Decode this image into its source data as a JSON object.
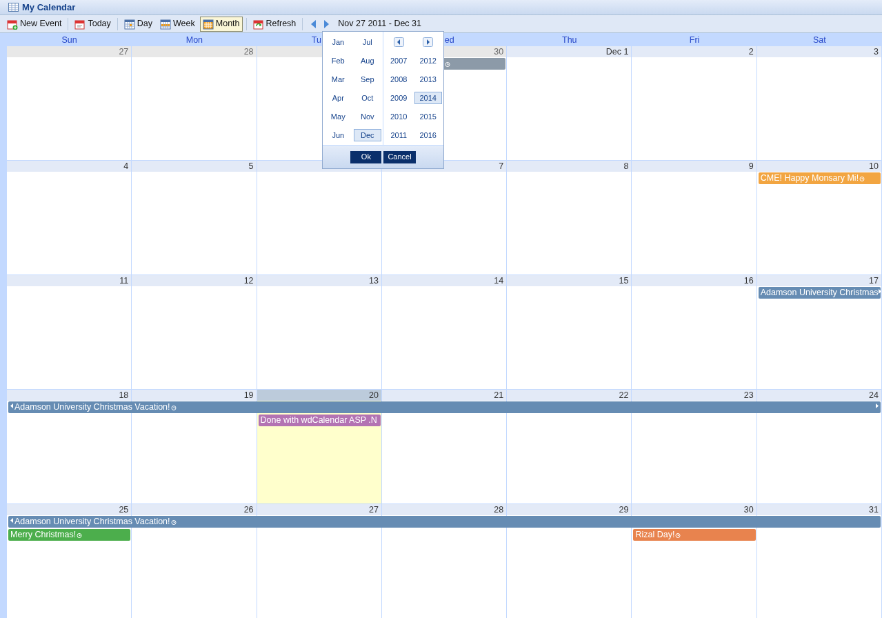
{
  "window": {
    "title": "My Calendar"
  },
  "toolbar": {
    "buttons": [
      {
        "label": "New Event",
        "kind": "new",
        "selected": false
      },
      {
        "label": "Today",
        "kind": "today",
        "selected": false
      },
      {
        "label": "Day",
        "kind": "day",
        "selected": false
      },
      {
        "label": "Week",
        "kind": "week",
        "selected": false
      },
      {
        "label": "Month",
        "kind": "month",
        "selected": true
      },
      {
        "label": "Refresh",
        "kind": "refresh",
        "selected": false
      }
    ],
    "range": "Nov 27 2011 - Dec 31"
  },
  "weekdays": [
    {
      "label": "Sun"
    },
    {
      "label": "Mon"
    },
    {
      "label": "Tu",
      "clipped_right": true
    },
    {
      "label": "ed",
      "clipped_left": true
    },
    {
      "label": "Thu"
    },
    {
      "label": "Fri"
    },
    {
      "label": "Sat"
    }
  ],
  "weeks": [
    {
      "days": [
        {
          "number": "27",
          "other_month": true
        },
        {
          "number": "28",
          "other_month": true
        },
        {
          "other_month": true
        },
        {
          "number": "30",
          "other_month": true,
          "events": [
            {
              "kind": "single",
              "color": "#8c9aa8",
              "alarm": true
            }
          ]
        },
        {
          "number": "Dec 1"
        },
        {
          "number": "2"
        },
        {
          "number": "3"
        }
      ]
    },
    {
      "days": [
        {
          "number": "4"
        },
        {
          "number": "5"
        },
        {
          "other_month": false
        },
        {
          "number": "7"
        },
        {
          "number": "8"
        },
        {
          "number": "9"
        },
        {
          "number": "10",
          "events": [
            {
              "kind": "single",
              "title": "CME! Happy Monsary Mi!",
              "color": "#f2a541",
              "alarm": true
            }
          ]
        }
      ]
    },
    {
      "days": [
        {
          "number": "11"
        },
        {
          "number": "12"
        },
        {
          "number": "13"
        },
        {
          "number": "14"
        },
        {
          "number": "15"
        },
        {
          "number": "16"
        },
        {
          "number": "17",
          "events": [
            {
              "kind": "week",
              "title": "Adamson University Christmas",
              "color": "#668cb3",
              "continues_after": true
            }
          ]
        }
      ]
    },
    {
      "days": [
        {
          "number": "18",
          "events": [
            {
              "kind": "week",
              "title": "Adamson University Christmas Vacation!",
              "color": "#668cb3",
              "alarm": true,
              "continues_before": true,
              "continues_after": true
            }
          ]
        },
        {
          "number": "19"
        },
        {
          "number": "20",
          "today": true,
          "events": [
            {
              "kind": "single",
              "title": "Done with wdCalendar ASP .N",
              "color": "#b373b3"
            }
          ]
        },
        {
          "number": "21"
        },
        {
          "number": "22"
        },
        {
          "number": "23"
        },
        {
          "number": "24"
        }
      ]
    },
    {
      "days": [
        {
          "number": "25",
          "events": [
            {
              "kind": "week",
              "title": "Adamson University Christmas Vacation!",
              "color": "#668cb3",
              "alarm": true,
              "continues_before": true
            },
            {
              "kind": "single",
              "title": "Merry Christmas!",
              "color": "#4cae4c",
              "alarm": true
            }
          ]
        },
        {
          "number": "26"
        },
        {
          "number": "27"
        },
        {
          "number": "28"
        },
        {
          "number": "29"
        },
        {
          "number": "30",
          "events": [
            {
              "kind": "single",
              "title": "Rizal Day!",
              "color": "#e8834e",
              "alarm": true
            }
          ]
        },
        {
          "number": "31"
        }
      ]
    }
  ],
  "picker": {
    "months": [
      {
        "label": "Jan",
        "selected": false
      },
      {
        "label": "Jul",
        "selected": false
      },
      {
        "label": "Feb",
        "selected": false
      },
      {
        "label": "Aug",
        "selected": false
      },
      {
        "label": "Mar",
        "selected": false
      },
      {
        "label": "Sep",
        "selected": false
      },
      {
        "label": "Apr",
        "selected": false
      },
      {
        "label": "Oct",
        "selected": false
      },
      {
        "label": "May",
        "selected": false
      },
      {
        "label": "Nov",
        "selected": false
      },
      {
        "label": "Jun",
        "selected": false
      },
      {
        "label": "Dec",
        "selected": true
      }
    ],
    "years": [
      {
        "label": "2007",
        "selected": false
      },
      {
        "label": "2012",
        "selected": false
      },
      {
        "label": "2008",
        "selected": false
      },
      {
        "label": "2013",
        "selected": false
      },
      {
        "label": "2009",
        "selected": false
      },
      {
        "label": "2014",
        "selected": true
      },
      {
        "label": "2010",
        "selected": false
      },
      {
        "label": "2015",
        "selected": false
      },
      {
        "label": "2011",
        "selected": false
      },
      {
        "label": "2016",
        "selected": false
      }
    ],
    "buttons": [
      "Ok",
      "Cancel"
    ]
  }
}
